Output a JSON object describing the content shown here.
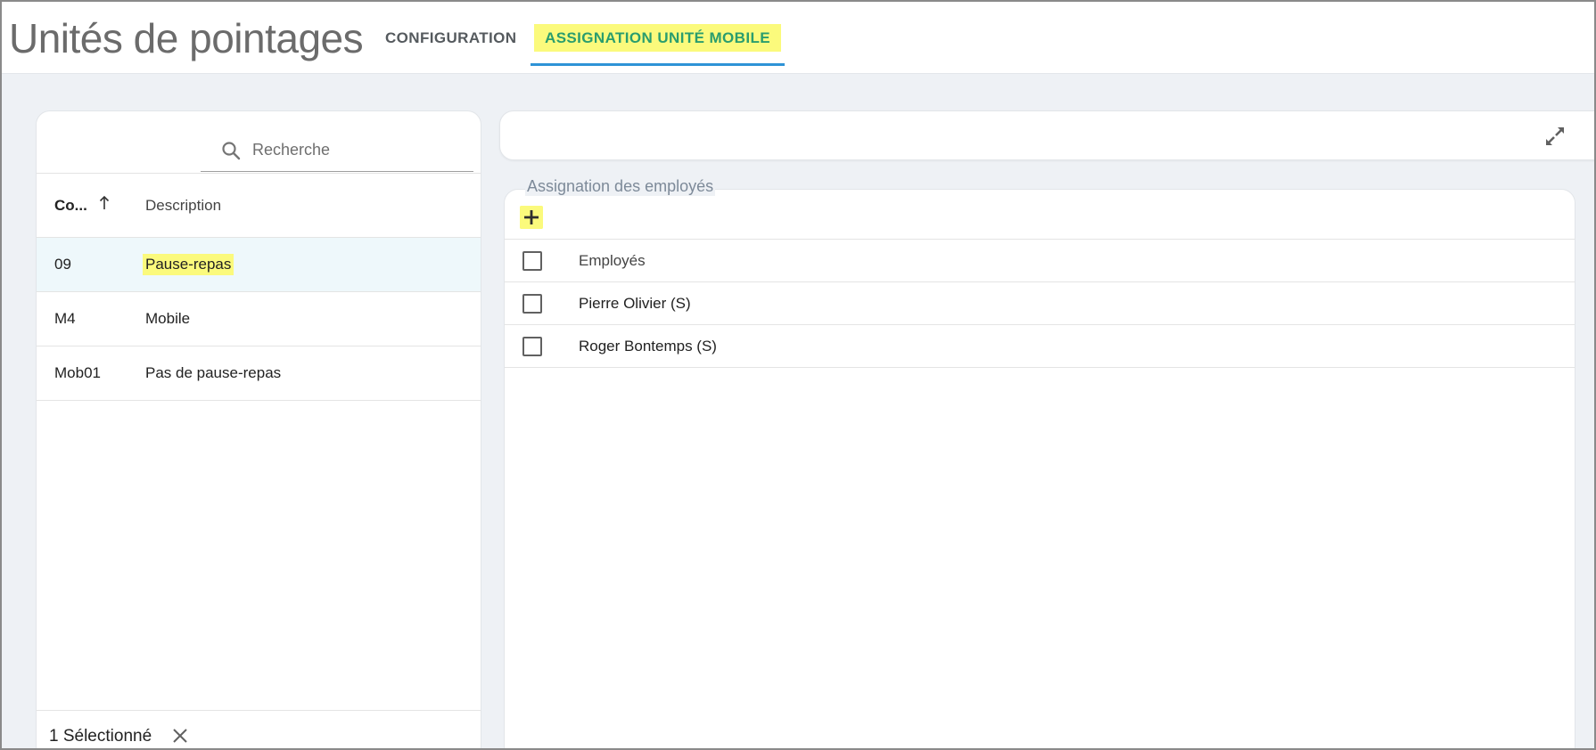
{
  "header": {
    "title": "Unités de pointages",
    "tabs": [
      {
        "label": "CONFIGURATION",
        "active": false
      },
      {
        "label": "ASSIGNATION UNITÉ MOBILE",
        "active": true
      }
    ]
  },
  "left_panel": {
    "search": {
      "placeholder": "Recherche",
      "value": "",
      "icon": "search-icon"
    },
    "columns": {
      "code": "Co...",
      "description": "Description",
      "sort": "ascending"
    },
    "rows": [
      {
        "code": "09",
        "description": "Pause-repas",
        "selected": true
      },
      {
        "code": "M4",
        "description": "Mobile",
        "selected": false
      },
      {
        "code": "Mob01",
        "description": "Pas de pause-repas",
        "selected": false
      }
    ],
    "footer": {
      "selection_text": "1 Sélectionné",
      "clear_icon": "close-icon"
    }
  },
  "right_panel": {
    "expand_icon": "expand-icon",
    "assignment": {
      "legend": "Assignation des employés",
      "add_icon": "plus-icon",
      "header": "Employés",
      "employees": [
        {
          "name": "Pierre Olivier (S)",
          "checked": false
        },
        {
          "name": "Roger Bontemps (S)",
          "checked": false
        }
      ]
    }
  },
  "colors": {
    "highlight": "#fbfa7c",
    "active_tab_text": "#2a9d6e",
    "active_tab_underline": "#2e93d6",
    "selected_row_bg": "#eef8fb",
    "background": "#eef1f5"
  }
}
